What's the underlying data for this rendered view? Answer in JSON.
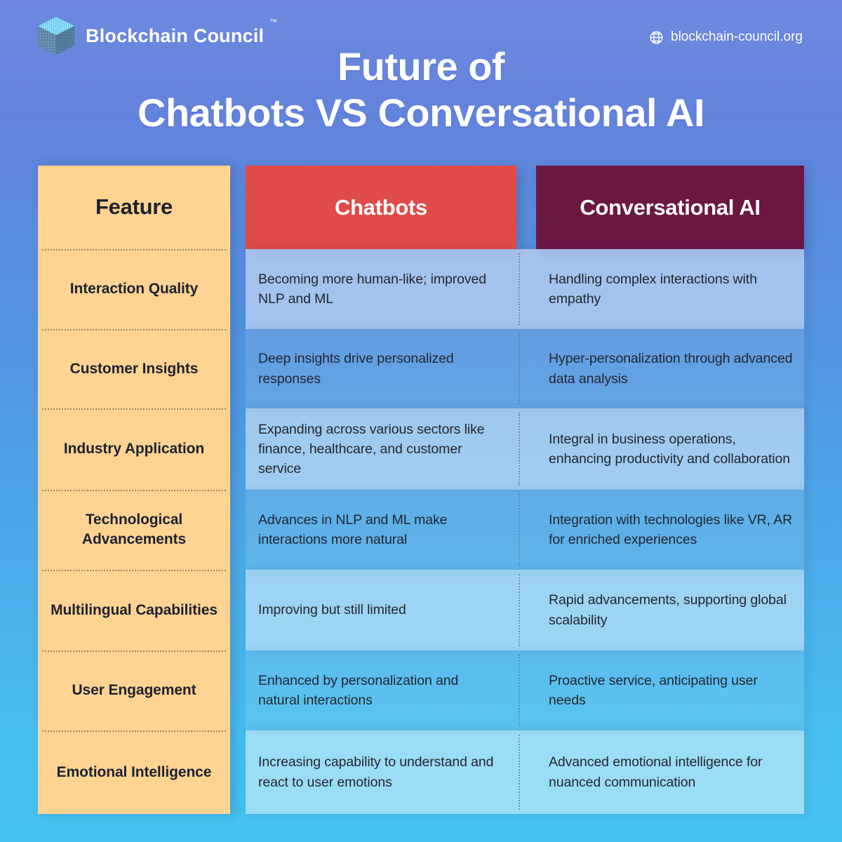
{
  "brand": {
    "logo_icon": "cube-logo-icon",
    "name": "Blockchain Council",
    "trademark": "™"
  },
  "site": {
    "globe_icon": "globe-icon",
    "url": "blockchain-council.org"
  },
  "title": {
    "line1": "Future of",
    "line2": "Chatbots VS Conversational AI"
  },
  "colors": {
    "background_top": "#6E88DE",
    "background_bottom": "#46C2F0",
    "feature_column": "#FFD392",
    "chatbots_header": "#E04B47",
    "conversational_ai_header": "#6B1744",
    "header_text": "#FFFFFF",
    "body_text": "#23272F"
  },
  "table": {
    "headers": {
      "feature": "Feature",
      "chatbots": "Chatbots",
      "conversational_ai": "Conversational AI"
    },
    "rows": [
      {
        "feature": "Interaction Quality",
        "chatbots": "Becoming more human-like; improved NLP and ML",
        "conversational_ai": "Handling complex interactions with empathy"
      },
      {
        "feature": "Customer Insights",
        "chatbots": "Deep insights drive personalized responses",
        "conversational_ai": "Hyper-personalization through advanced data analysis"
      },
      {
        "feature": "Industry Application",
        "chatbots": "Expanding across various sectors like finance, healthcare, and customer service",
        "conversational_ai": "Integral in business operations, enhancing productivity and collaboration"
      },
      {
        "feature": "Technological Advancements",
        "chatbots": "Advances in NLP and ML make interactions more natural",
        "conversational_ai": "Integration with technologies like VR, AR for enriched experiences"
      },
      {
        "feature": "Multilingual Capabilities",
        "chatbots": "Improving but still limited",
        "conversational_ai": "Rapid advancements, supporting global scalability"
      },
      {
        "feature": "User Engagement",
        "chatbots": "Enhanced by personalization and natural interactions",
        "conversational_ai": "Proactive service, anticipating user needs"
      },
      {
        "feature": "Emotional Intelligence",
        "chatbots": "Increasing capability to understand and react to user emotions",
        "conversational_ai": "Advanced emotional intelligence for nuanced communication"
      }
    ]
  }
}
